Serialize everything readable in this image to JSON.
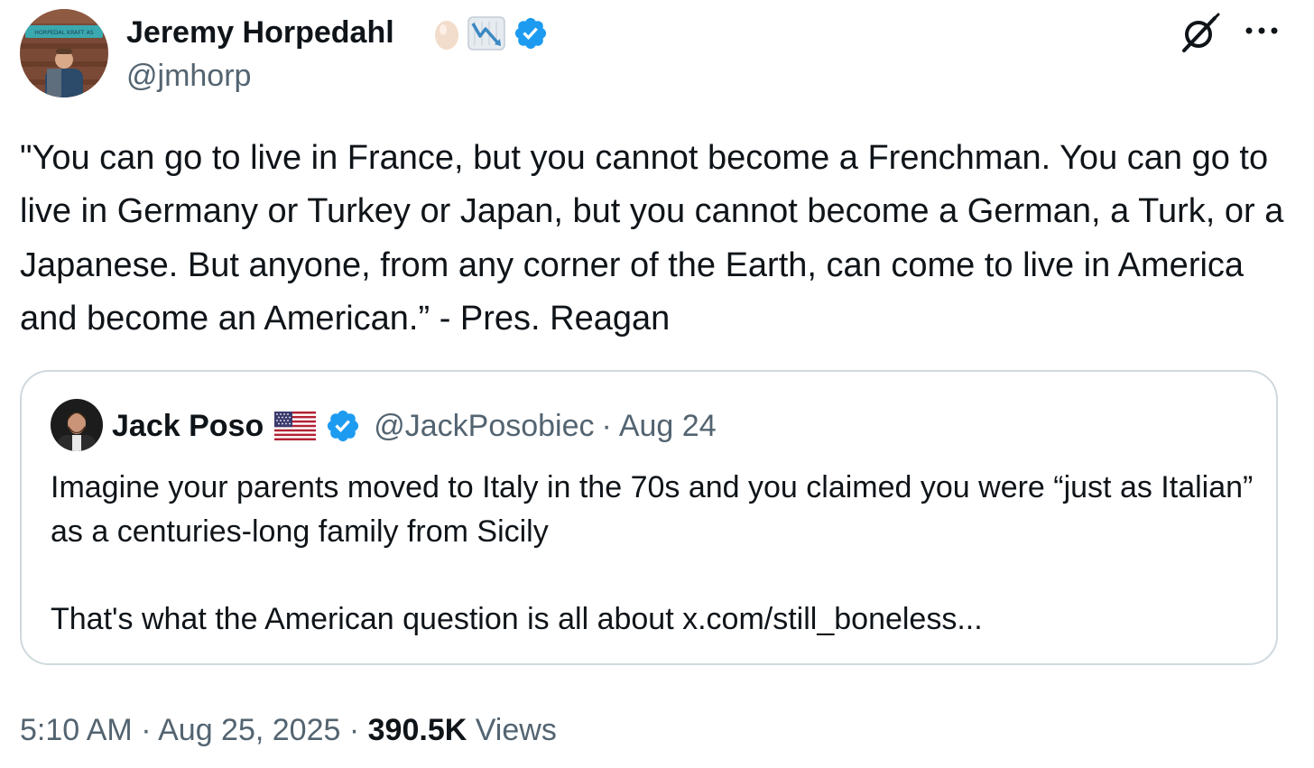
{
  "author": {
    "name": "Jeremy Horpedahl",
    "handle": "@jmhorp",
    "avatar_banner_text": "HORPEDAL KRAFT AS"
  },
  "tweet": {
    "text": "\"You can go to live in France, but you cannot become a Frenchman. You can go to live in Germany or Turkey or Japan, but you cannot become a German, a Turk, or a Japanese. But anyone, from any corner of the Earth, can come to live in America and become an American.” - Pres. Reagan"
  },
  "quoted": {
    "name": "Jack Poso",
    "handle": "@JackPosobiec",
    "separator": "·",
    "date": "Aug 24",
    "text": "Imagine your parents moved to Italy in the 70s and you claimed you were “just as Italian” as a centuries-long family from Sicily",
    "text_2": "That's what the American question is all about x.com/still_boneless..."
  },
  "footer": {
    "time": "5:10 AM",
    "separator": "·",
    "date": "Aug 25, 2025",
    "views_count": "390.5K",
    "views_label": "Views"
  },
  "icons": {
    "verified": "verified-badge-icon",
    "grok": "grok-icon",
    "more": "more-options-icon",
    "egg": "egg-emoji",
    "chart": "chart-decreasing-emoji",
    "flag": "us-flag-emoji"
  },
  "colors": {
    "text": "#0f1419",
    "secondary": "#536471",
    "verified": "#1d9bf0",
    "border": "#cfd9de"
  }
}
